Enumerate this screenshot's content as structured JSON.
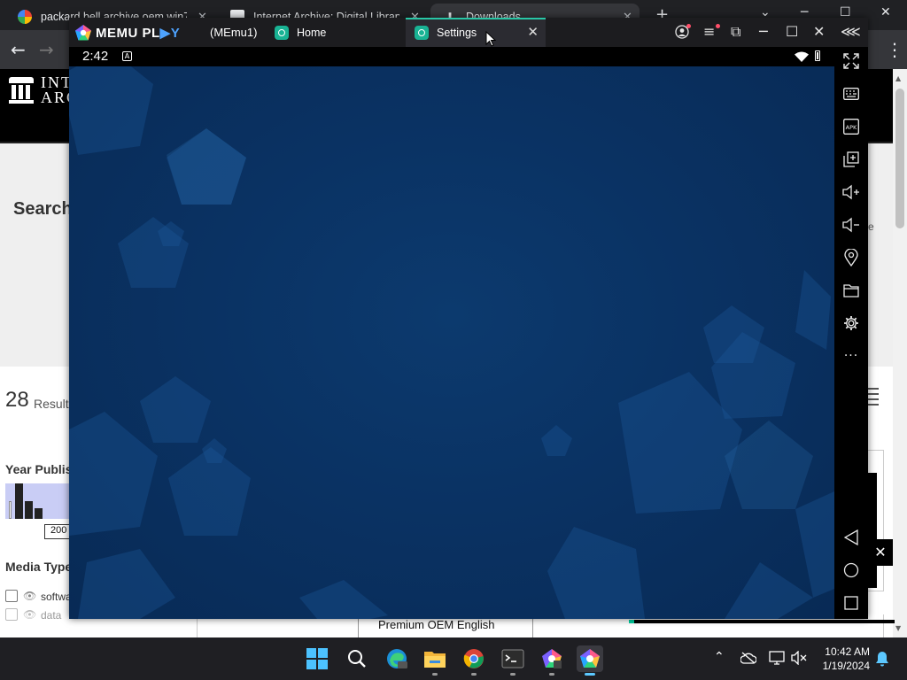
{
  "chrome": {
    "tabs": [
      {
        "title": "packard bell archive oem win7 -",
        "icon": "google-icon",
        "close": "✕"
      },
      {
        "title": "Internet Archive: Digital Library o",
        "icon": "archive-icon",
        "close": "✕"
      },
      {
        "title": "Downloads",
        "icon": "download-icon",
        "close": "✕"
      }
    ],
    "new_tab": "+",
    "window_controls": {
      "minimize": "─",
      "maximize": "☐",
      "close": "✕",
      "tab_search": "⌄"
    },
    "toolbar": {
      "back": "←",
      "forward": "→",
      "menu": "⋮"
    }
  },
  "archive_page": {
    "logo_text_line1": "INT",
    "logo_text_line2": "ARC",
    "search_heading": "Search",
    "results_count": "28",
    "results_label": "Result",
    "year_heading": "Year Publis",
    "year_input": "200",
    "media_heading": "Media Type",
    "media_items": [
      "softwa",
      "data"
    ],
    "right_note": "e",
    "table_cell": "Premium OEM English"
  },
  "memu": {
    "brand_main": "MEMU PL",
    "brand_accent": "▶Y",
    "instance": "(MEmu1)",
    "tabs": [
      {
        "label": "Home",
        "icon": "app-icon"
      },
      {
        "label": "Settings",
        "icon": "settings-app-icon",
        "close": "✕"
      }
    ],
    "controls": {
      "account": "◯",
      "menu": "≡",
      "multi": "⧉",
      "minimize": "─",
      "maximize": "☐",
      "close": "✕",
      "collapse": "⋘"
    },
    "status": {
      "time": "2:42",
      "notification": "A"
    },
    "sidebar": [
      {
        "name": "fullscreen-icon"
      },
      {
        "name": "keyboard-icon"
      },
      {
        "name": "apk-icon",
        "text": "APK"
      },
      {
        "name": "multi-window-icon"
      },
      {
        "name": "volume-up-icon"
      },
      {
        "name": "volume-down-icon"
      },
      {
        "name": "location-icon"
      },
      {
        "name": "folder-icon"
      },
      {
        "name": "settings-icon"
      },
      {
        "name": "more-icon",
        "text": "···"
      },
      {
        "name": "back-icon"
      },
      {
        "name": "home-icon"
      },
      {
        "name": "recents-icon"
      }
    ],
    "ad_close": "✕"
  },
  "taskbar": {
    "time": "10:42 AM",
    "date": "1/19/2024",
    "tray_chevron": "⌃",
    "apps": [
      "start-icon",
      "search-icon",
      "edge-icon",
      "file-explorer-icon",
      "chrome-icon",
      "terminal-icon",
      "memu-multi-icon",
      "memu-icon"
    ]
  },
  "colors": {
    "memu_accent": "#28c7a6",
    "android_bg": "#0a3263",
    "taskbar_accent": "#5cc8ff"
  }
}
